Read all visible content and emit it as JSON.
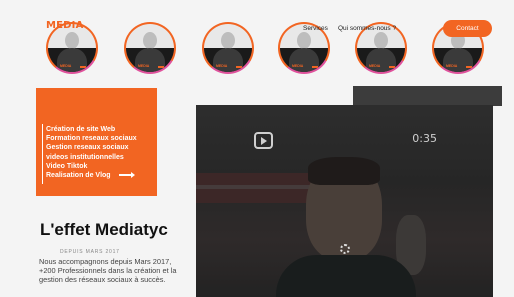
{
  "header": {
    "logo_text": "MEDIA",
    "nav": [
      "Services",
      "Qui sommes-nous ?"
    ],
    "contact_label": "Contact"
  },
  "avatars": [
    "avatar-1",
    "avatar-2",
    "avatar-3",
    "avatar-4",
    "avatar-5",
    "avatar-6"
  ],
  "services": {
    "items": [
      "Création de site Web",
      "Formation reseaux sociaux",
      "Gestion  reseaux sociaux",
      "videos institutionnelles",
      "Video Tiktok",
      "Realisation de Vlog"
    ]
  },
  "about": {
    "heading": "L'effet Mediatyc",
    "since": "DEPUIS MARS 2017",
    "description": "Nous accompagnons depuis Mars 2017, +200 Professionnels dans la création et la gestion des réseaux sociaux à succès."
  },
  "video": {
    "duration": "0:35",
    "reel_icon": "reel-icon",
    "loading_icon": "spinner-icon"
  },
  "colors": {
    "accent": "#f26522",
    "ring_secondary": "#e0529c"
  }
}
